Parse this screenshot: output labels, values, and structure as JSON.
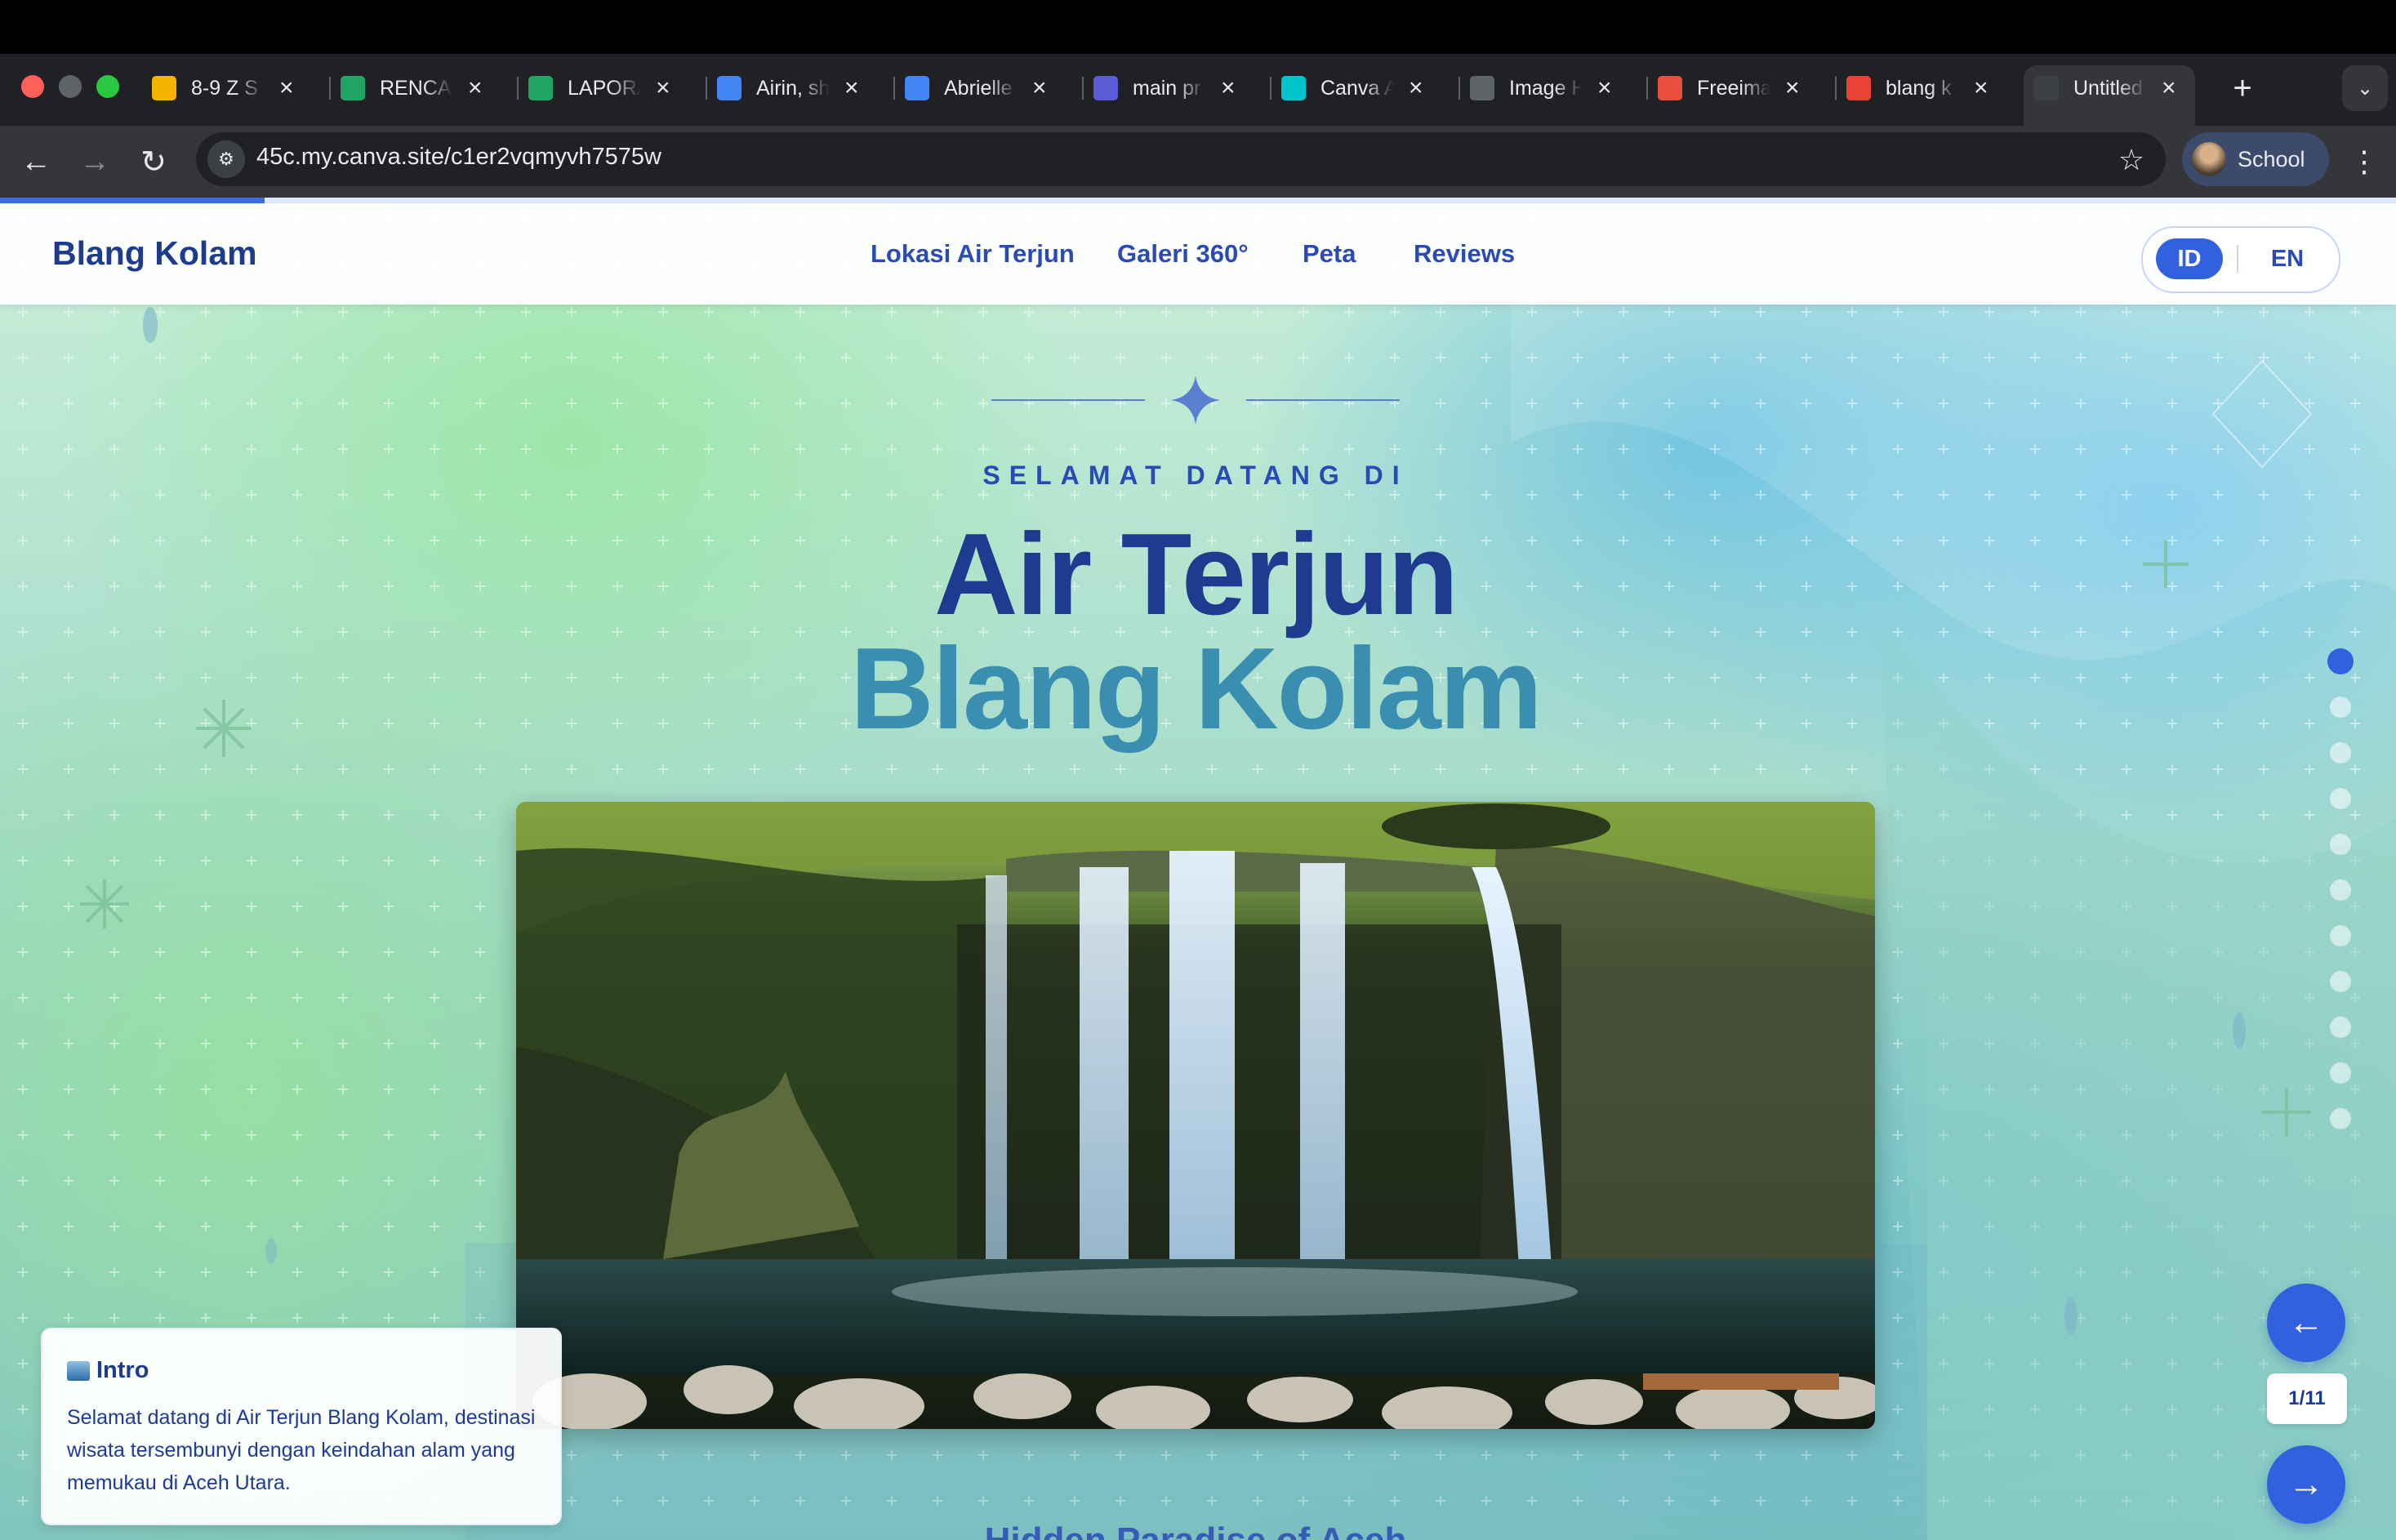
{
  "browser": {
    "tabs": [
      {
        "title": "8-9 Z S",
        "favicon": "slides-icon",
        "color": "#f4b400"
      },
      {
        "title": "RENCANA",
        "favicon": "drive-icon",
        "color": "#1fa463"
      },
      {
        "title": "LAPORAN",
        "favicon": "drive-icon",
        "color": "#1fa463"
      },
      {
        "title": "Airin, sh",
        "favicon": "docs-icon",
        "color": "#4285f4"
      },
      {
        "title": "Abrielle",
        "favicon": "docs-icon",
        "color": "#4285f4"
      },
      {
        "title": "main pr",
        "favicon": "app-icon",
        "color": "#5b5bd6"
      },
      {
        "title": "Canva A",
        "favicon": "canva-icon",
        "color": "#00c4cc"
      },
      {
        "title": "Image H",
        "favicon": "image-icon",
        "color": "#5f6368"
      },
      {
        "title": "Freeima",
        "favicon": "freepik-icon",
        "color": "#e94e3c"
      },
      {
        "title": "blang k",
        "favicon": "google-icon",
        "color": "#ea4335"
      },
      {
        "title": "Untitled",
        "favicon": "canva-site-icon",
        "color": "#3c4043"
      }
    ],
    "url": "45c.my.canva.site/c1er2vqmyvh7575w",
    "profile_label": "School"
  },
  "site": {
    "logo": "Blang Kolam",
    "nav": [
      "Lokasi Air Terjun",
      "Galeri 360°",
      "Peta",
      "Reviews"
    ],
    "lang_active": "ID",
    "lang_other": "EN",
    "progress_fraction": 0.11
  },
  "hero": {
    "eyebrow": "SELAMAT DATANG DI",
    "title_line1": "Air Terjun",
    "title_line2": "Blang Kolam",
    "image_alt": "waterfall-photo",
    "subheading_partial": "Hidden Paradise of Aceh"
  },
  "info_card": {
    "title": "Intro",
    "body": "Selamat datang di Air Terjun Blang Kolam, destinasi wisata tersembunyi dengan keindahan alam yang memukau di Aceh Utara."
  },
  "pager": {
    "counter": "1/11",
    "total_dots": 11,
    "active_index": 1
  },
  "colors": {
    "primary": "#3161de",
    "heading_dark": "#1f3b8f",
    "heading_teal": "#3a8fb0"
  }
}
